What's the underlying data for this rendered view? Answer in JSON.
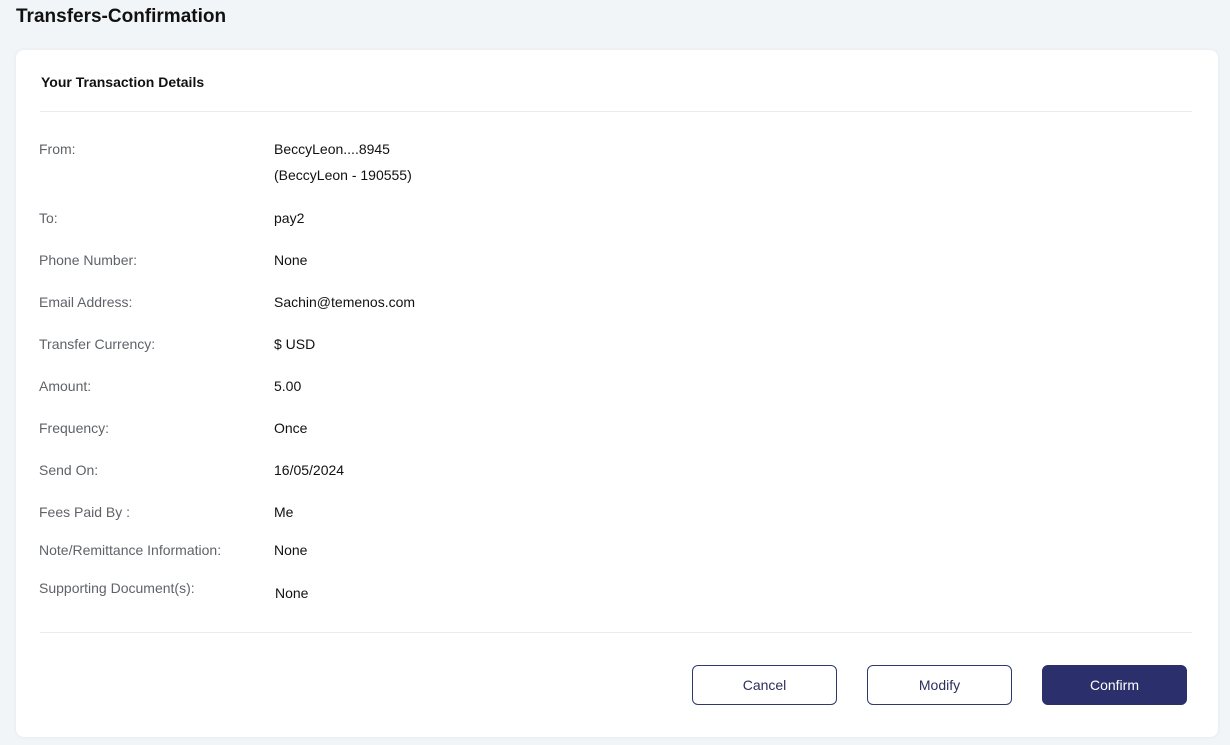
{
  "page": {
    "title": "Transfers-Confirmation"
  },
  "card": {
    "header": "Your Transaction Details"
  },
  "details": [
    {
      "label": "From:",
      "value": "BeccyLeon....8945",
      "value2": "(BeccyLeon - 190555)"
    },
    {
      "label": "To:",
      "value": "pay2"
    },
    {
      "label": "Phone Number:",
      "value": "None"
    },
    {
      "label": "Email Address:",
      "value": "Sachin@temenos.com"
    },
    {
      "label": "Transfer Currency:",
      "value": "$ USD"
    },
    {
      "label": "Amount:",
      "value": "5.00"
    },
    {
      "label": "Frequency:",
      "value": "Once"
    },
    {
      "label": "Send On:",
      "value": "16/05/2024"
    },
    {
      "label": "Fees Paid By :",
      "value": "Me"
    },
    {
      "label": "Note/Remittance Information:",
      "value": "None"
    },
    {
      "label": "Supporting Document(s):",
      "value": "None"
    }
  ],
  "actions": {
    "cancel": "Cancel",
    "modify": "Modify",
    "confirm": "Confirm"
  },
  "colors": {
    "primary": "#2b2f6b",
    "background": "#f2f5f8",
    "label": "#5f6368"
  }
}
